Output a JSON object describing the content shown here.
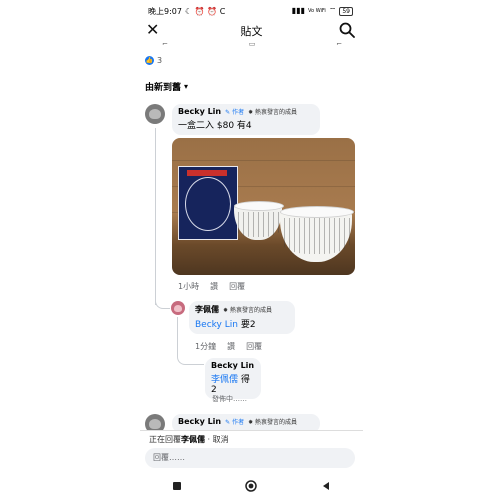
{
  "status_bar": {
    "time": "晚上9:07",
    "carrier_icons": "☾ ⏰ ⏰ C",
    "network": "Vo WiFi",
    "battery": "59"
  },
  "header": {
    "title": "貼文"
  },
  "reactions": {
    "count": "3"
  },
  "sort": {
    "label": "由新到舊"
  },
  "comments": [
    {
      "author": "Becky Lin",
      "author_badge": "作者",
      "member_badge": "熱衷發言的成員",
      "text": "一盒二入 $80 有4",
      "time": "1小時",
      "like": "讚",
      "reply": "回覆"
    }
  ],
  "replies": [
    {
      "author": "李佩儒",
      "member_badge": "熱衷發言的成員",
      "mention": "Becky Lin",
      "text": " 要2",
      "time": "1分鐘",
      "like": "讚",
      "reply": "回覆"
    },
    {
      "author": "Becky Lin",
      "mention": "李佩儒",
      "text": " 得2",
      "status": "發佈中……"
    }
  ],
  "next_comment": {
    "author": "Becky Lin",
    "author_badge": "作者",
    "member_badge": "熱衷發言的成員"
  },
  "reply_footer": {
    "prefix": "正在回覆",
    "target": "李佩儒",
    "cancel": "· 取消",
    "placeholder": "回覆……"
  },
  "colors": {
    "accent": "#1877f2",
    "bubble": "#f0f2f5"
  }
}
